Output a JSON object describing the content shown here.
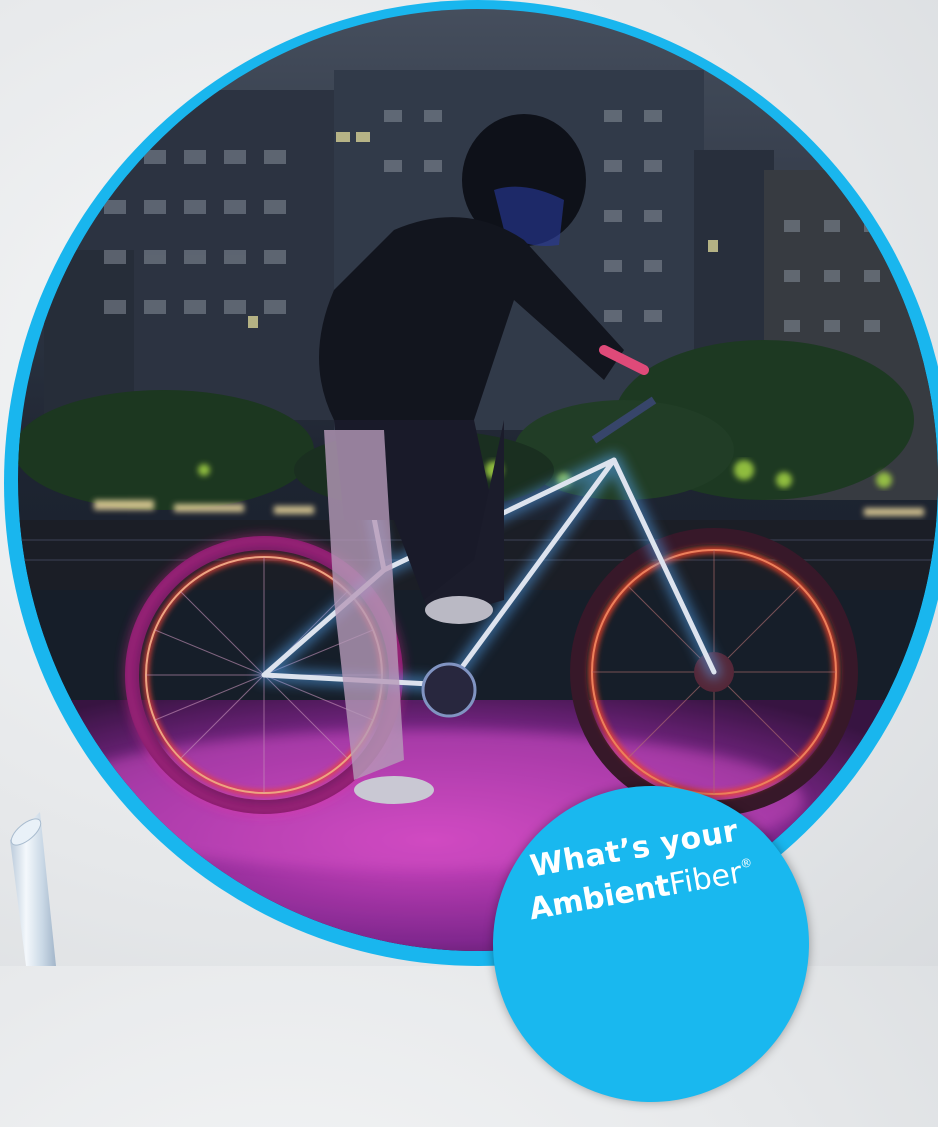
{
  "image": {
    "subject": "cyclist-with-glowing-bike",
    "palette": {
      "ring": "#19b6ee",
      "badge": "#19b8ef",
      "frame_glow": "#e8f2ff",
      "wheel_glow": "#ff4a3a",
      "ground_glow": "#d23cc4",
      "sky": "#2b3442"
    }
  },
  "badge": {
    "line1": "What’s your",
    "brand_bold": "Ambient",
    "brand_light": "Fiber",
    "registered": "®"
  }
}
